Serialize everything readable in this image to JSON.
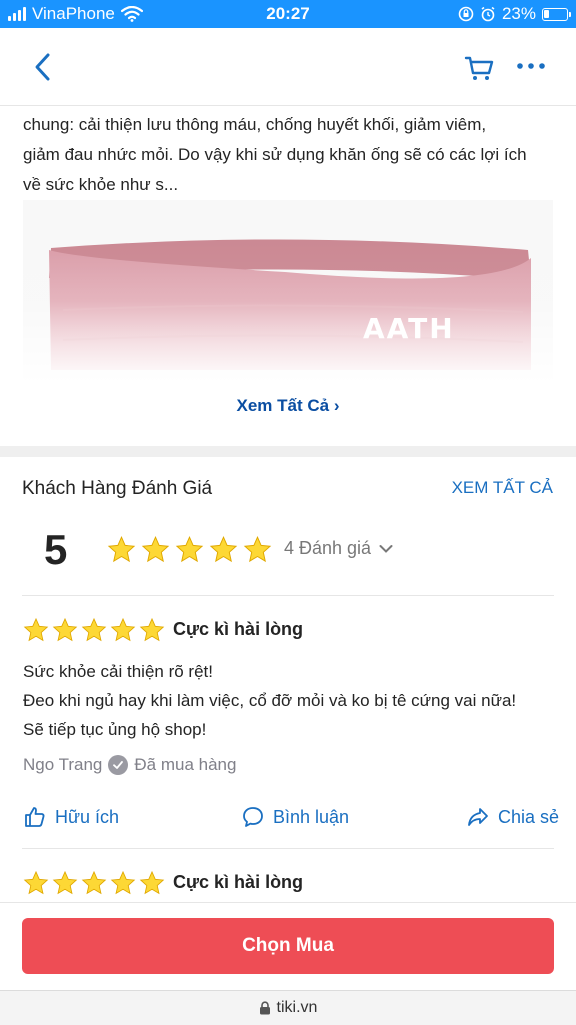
{
  "status_bar": {
    "carrier": "VinaPhone",
    "time": "20:27",
    "battery": "23%",
    "battery_level": 0.23,
    "icons": [
      "signal-icon",
      "wifi-icon",
      "orientation-lock-icon",
      "alarm-icon",
      "battery-icon"
    ]
  },
  "nav": {
    "icons": [
      "back-arrow-icon",
      "cart-icon",
      "more-icon"
    ],
    "accent": "#1a94ff"
  },
  "description": {
    "lines": [
      "chung: cải thiện lưu thông máu, chống huyết khối, giảm viêm,",
      "giảm đau nhức mỏi. Do vậy khi sử dụng khăn ống sẽ có các lợi ích",
      "về sức khỏe như s..."
    ],
    "image_logo_text": "AATH",
    "see_all": "Xem Tất Cả"
  },
  "reviews": {
    "title": "Khách Hàng Đánh Giá",
    "see_all": "XEM TẤT CẢ",
    "average": "5",
    "average_stars": 5,
    "count_label": "4 Đánh giá",
    "items": [
      {
        "stars": 5,
        "title": "Cực kì hài lòng",
        "lines": [
          "Sức khỏe cải thiện rõ rệt!",
          "Đeo khi ngủ hay khi làm việc, cổ đỡ mỏi và ko bị tê cứng vai nữa!",
          "Sẽ tiếp tục ủng hộ shop!"
        ],
        "author": "Ngo Trang",
        "verified": "Đã mua hàng",
        "actions": {
          "helpful": "Hữu ích",
          "comment": "Bình luận",
          "share": "Chia sẻ"
        }
      },
      {
        "stars": 5,
        "title": "Cực kì hài lòng"
      }
    ]
  },
  "buy_button": "Chọn Mua",
  "url": "tiki.vn",
  "colors": {
    "star": "#fdd835",
    "link": "#1a6fc1",
    "buy": "#ee4d55",
    "status_bar": "#1a94ff"
  }
}
